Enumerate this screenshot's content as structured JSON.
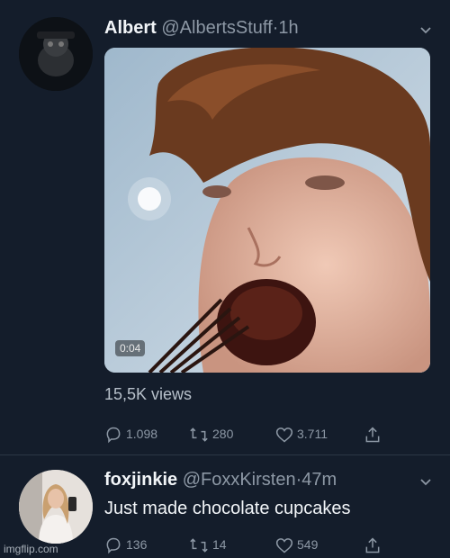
{
  "tweets": [
    {
      "display_name": "Albert",
      "handle": "@AlbertsStuff",
      "separator": "·",
      "time": "1h",
      "video_duration": "0:04",
      "views": "15,5K views",
      "replies": "1.098",
      "retweets": "280",
      "likes": "3.711"
    },
    {
      "display_name": "foxjinkie",
      "handle": "@FoxxKirsten",
      "separator": "·",
      "time": "47m",
      "text": "Just made chocolate cupcakes",
      "replies": "136",
      "retweets": "14",
      "likes": "549"
    }
  ],
  "watermark": "imgflip.com",
  "icons": [
    "chevron-down-icon",
    "reply-icon",
    "retweet-icon",
    "like-icon",
    "share-icon"
  ]
}
